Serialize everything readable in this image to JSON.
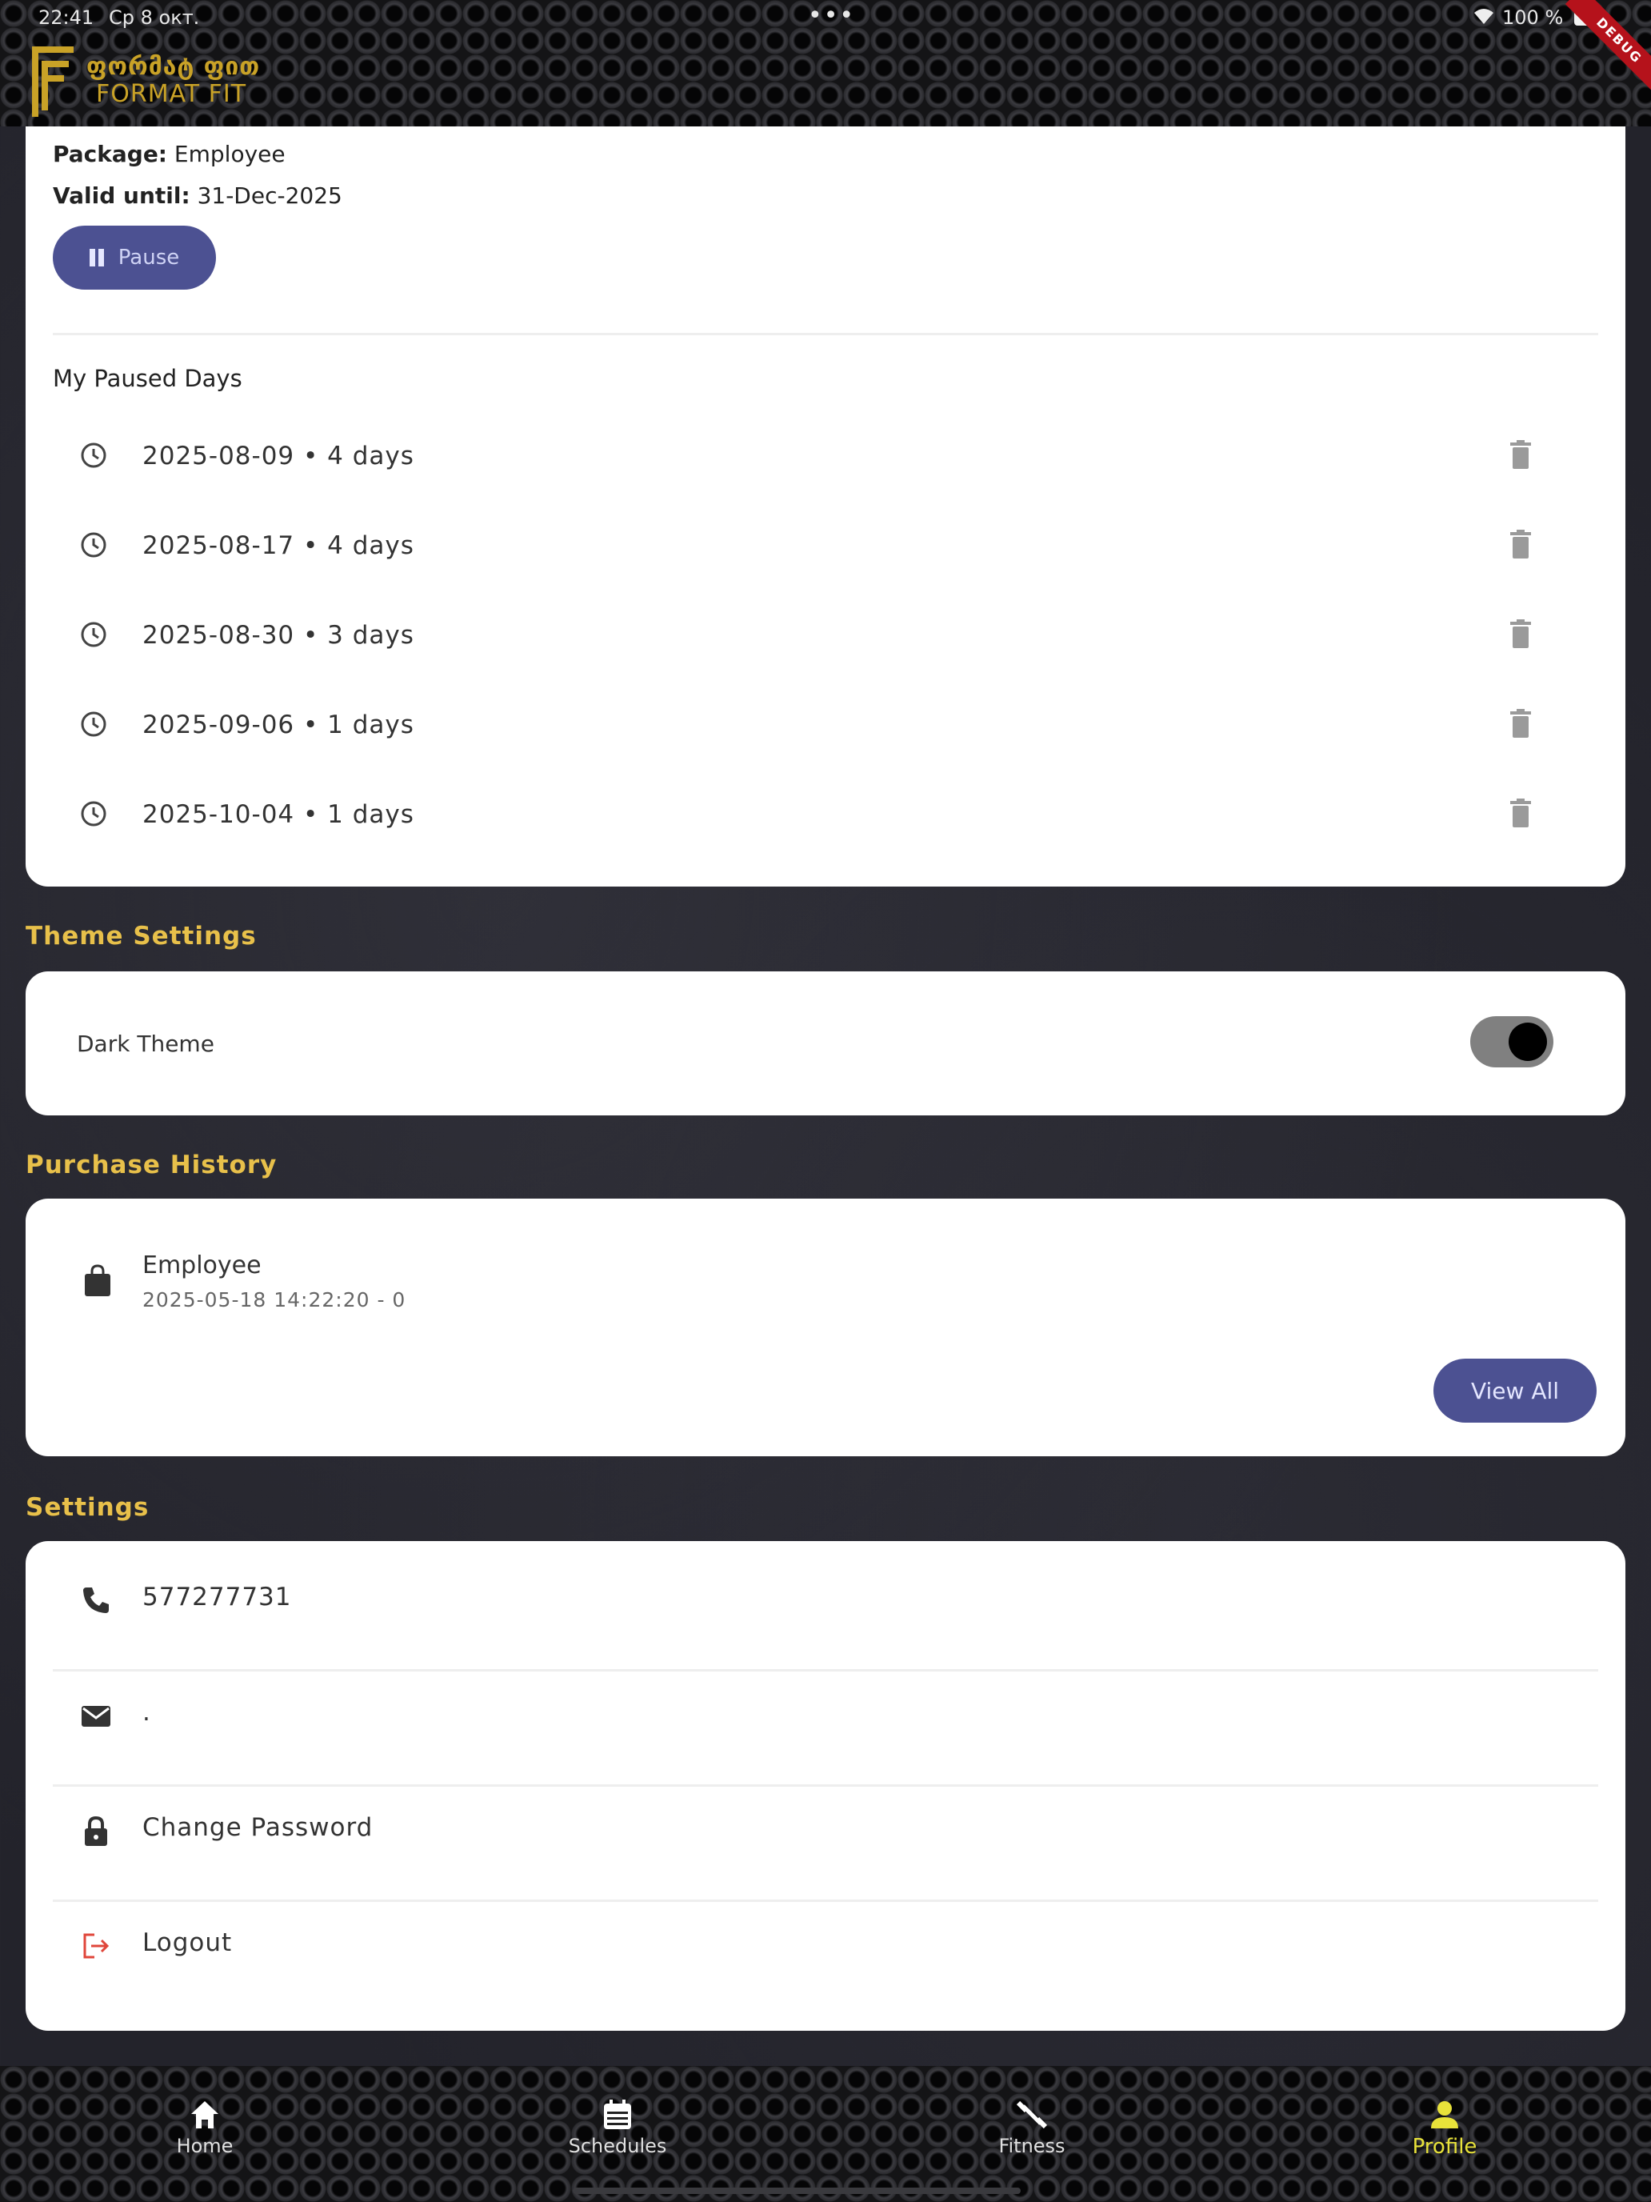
{
  "status_bar": {
    "time": "22:41",
    "date": "Ср 8 окт.",
    "dots": "•••",
    "battery_text": "100 %",
    "debug_label": "DEBUG"
  },
  "logo": {
    "line1": "ფორმატ ფით",
    "line2": "FORMAT FIT"
  },
  "membership": {
    "package_label": "Package:",
    "package_value": "Employee",
    "valid_label": "Valid until:",
    "valid_value": "31-Dec-2025",
    "pause_label": "Pause"
  },
  "paused_days": {
    "title": "My Paused Days",
    "items": [
      {
        "text": "2025-08-09 • 4 days"
      },
      {
        "text": "2025-08-17 • 4 days"
      },
      {
        "text": "2025-08-30 • 3 days"
      },
      {
        "text": "2025-09-06 • 1 days"
      },
      {
        "text": "2025-10-04 • 1 days"
      }
    ]
  },
  "theme_settings": {
    "title": "Theme Settings",
    "dark_theme_label": "Dark Theme",
    "dark_theme_on": true
  },
  "purchase_history": {
    "title": "Purchase History",
    "items": [
      {
        "name": "Employee",
        "meta": "2025-05-18 14:22:20 - 0"
      }
    ],
    "view_all_label": "View All"
  },
  "settings": {
    "title": "Settings",
    "phone": "577277731",
    "email": ".",
    "change_password_label": "Change Password",
    "logout_label": "Logout"
  },
  "bottom_nav": {
    "items": [
      {
        "label": "Home",
        "icon": "home-icon"
      },
      {
        "label": "Schedules",
        "icon": "calendar-icon"
      },
      {
        "label": "Fitness",
        "icon": "dumbbell-icon"
      },
      {
        "label": "Profile",
        "icon": "person-icon",
        "active": true
      }
    ]
  },
  "colors": {
    "accent": "#4c5192",
    "section_title": "#e8c04a",
    "active_nav": "#e8e23a",
    "logout_icon": "#e0463a"
  }
}
